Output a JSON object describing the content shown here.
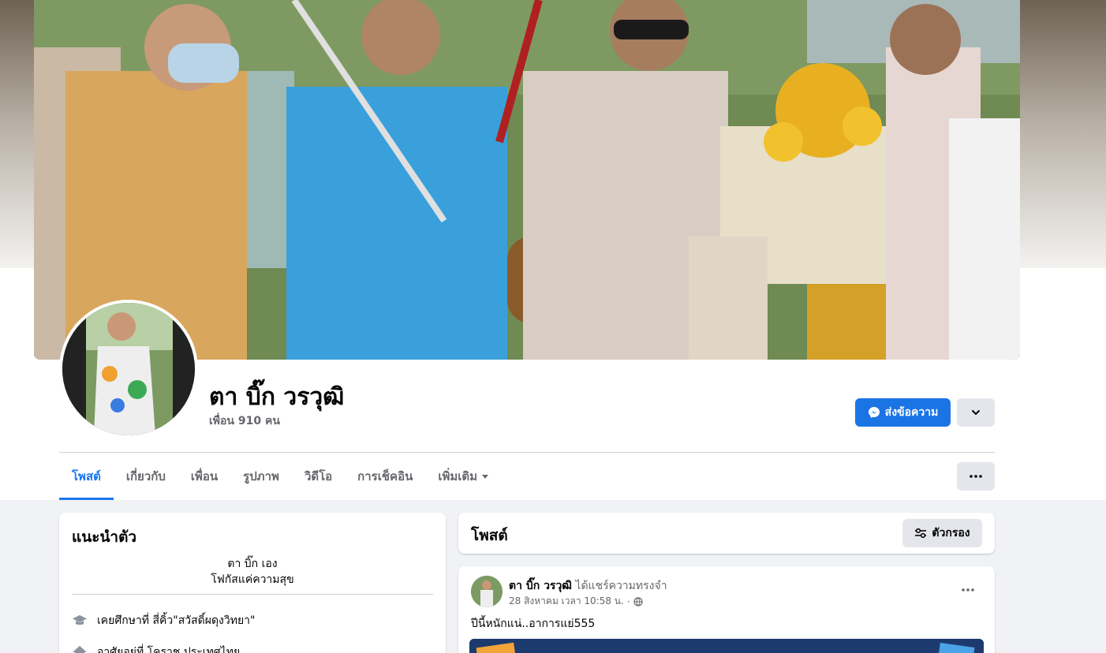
{
  "profile": {
    "name": "ตา บิ๊ก วรวุฒิ",
    "friends": "เพื่อน 910 คน",
    "message_button": "ส่งข้อความ"
  },
  "tabs": [
    {
      "label": "โพสต์",
      "active": true
    },
    {
      "label": "เกี่ยวกับ"
    },
    {
      "label": "เพื่อน"
    },
    {
      "label": "รูปภาพ"
    },
    {
      "label": "วิดีโอ"
    },
    {
      "label": "การเช็คอิน"
    },
    {
      "label": "เพิ่มเติม"
    }
  ],
  "intro": {
    "title": "แนะนำตัว",
    "bio_line1": "ตา บิ๊ก เอง",
    "bio_line2": "โฟกัสแค่ความสุข",
    "studied": "เคยศึกษาที่ สี่คิ้ว\"สวัสดิ์ผดุงวิทยา\"",
    "lives": "อาศัยอยู่ที่ โคราช ประเทศไทย"
  },
  "posts": {
    "title": "โพสต์",
    "filter_label": "ตัวกรอง"
  },
  "post": {
    "author": "ตา บิ๊ก วรวุฒิ",
    "action": "ได้แชร์ความทรงจำ",
    "time": "28 สิงหาคม เวลา 10:58 น.",
    "separator": "·",
    "text": "ปีนี้หนักแน่..อาการแย่555"
  },
  "colors": {
    "accent": "#1877f2",
    "button_blue": "#1b74e4",
    "background": "#f0f2f5"
  }
}
